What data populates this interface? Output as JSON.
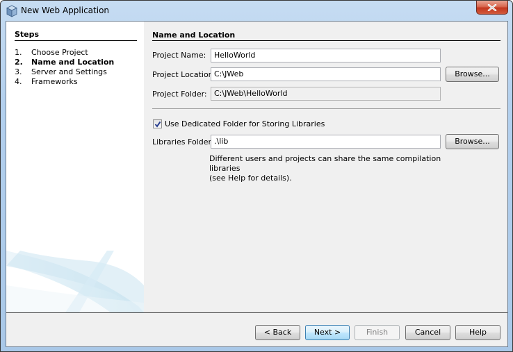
{
  "window": {
    "title": "New Web Application",
    "icon": "netbeans-cube-icon",
    "close_icon": "close-icon"
  },
  "steps": {
    "title": "Steps",
    "items": [
      {
        "num": "1.",
        "label": "Choose Project",
        "active": false
      },
      {
        "num": "2.",
        "label": "Name and Location",
        "active": true
      },
      {
        "num": "3.",
        "label": "Server and Settings",
        "active": false
      },
      {
        "num": "4.",
        "label": "Frameworks",
        "active": false
      }
    ]
  },
  "panel": {
    "title": "Name and Location",
    "project_name": {
      "label": "Project Name:",
      "value": "HelloWorld"
    },
    "project_location": {
      "label": "Project Location:",
      "value": "C:\\JWeb",
      "browse_label": "Browse..."
    },
    "project_folder": {
      "label": "Project Folder:",
      "value": "C:\\JWeb\\HelloWorld"
    },
    "dedicated_folder": {
      "label": "Use Dedicated Folder for Storing Libraries",
      "checked": true
    },
    "libraries_folder": {
      "label": "Libraries Folder:",
      "value": ".\\lib",
      "browse_label": "Browse..."
    },
    "hint_line1": "Different users and projects can share the same compilation libraries",
    "hint_line2": "(see Help for details)."
  },
  "footer": {
    "back_label": "< Back",
    "next_label": "Next >",
    "finish_label": "Finish",
    "cancel_label": "Cancel",
    "help_label": "Help"
  }
}
